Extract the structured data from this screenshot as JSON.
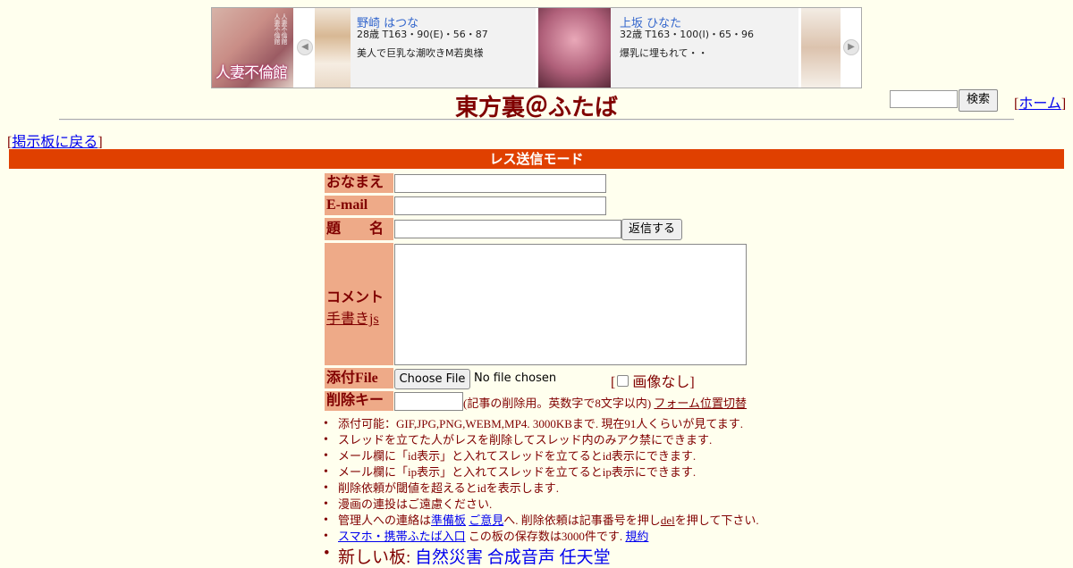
{
  "banner": {
    "logo_text": "人妻不倫館",
    "cards": [
      {
        "name": "野崎 はつな",
        "stats": "28歳 T163・90(E)・56・87",
        "desc": "美人で巨乳な潮吹きM若奥様"
      },
      {
        "name": "上坂 ひなた",
        "stats": "32歳 T163・100(I)・65・96",
        "desc": "爆乳に埋もれて・・"
      }
    ]
  },
  "header": {
    "title": "東方裏＠ふたば",
    "search_button": "検索",
    "home_link": "ホーム"
  },
  "nav": {
    "back_link": "掲示板に戻る"
  },
  "mode_bar": "レス送信モード",
  "form": {
    "name_label": "おなまえ",
    "email_label": "E-mail",
    "subject_label": "題　　名",
    "submit_button": "返信する",
    "comment_label": "コメント",
    "handwriting_link": "手書きjs",
    "file_label": "添付File",
    "choose_file_button": "Choose File",
    "no_file_text": "No file chosen",
    "no_image_label": "画像なし",
    "delete_key_label": "削除キー",
    "delete_key_hint": "(記事の削除用。英数字で8文字以内)",
    "form_position_link": "フォーム位置切替"
  },
  "notes": {
    "n1": "添付可能：GIF,JPG,PNG,WEBM,MP4. 3000KBまで. 現在91人くらいが見てます.",
    "n2": "スレッドを立てた人がレスを削除してスレッド内のみアク禁にできます.",
    "n3": "メール欄に「id表示」と入れてスレッドを立てるとid表示にできます.",
    "n4": "メール欄に「ip表示」と入れてスレッドを立てるとip表示にできます.",
    "n5": "削除依頼が閾値を超えるとidを表示します.",
    "n6": "漫画の連投はご遠慮ください.",
    "n7_prefix": "管理人への連絡は",
    "n7_link1": "準備板",
    "n7_link2": "ご意見",
    "n7_mid": "へ. 削除依頼は記事番号を押し",
    "n7_link3": "del",
    "n7_suffix": "を押して下さい.",
    "n8_link": "スマホ・携帯ふたば入口",
    "n8_text": " この板の保存数は3000件です.",
    "n8_link2": "規約",
    "new_boards_label": "新しい板:",
    "new_board_1": "自然災害",
    "new_board_2": "合成音声",
    "new_board_3": "任天堂"
  }
}
